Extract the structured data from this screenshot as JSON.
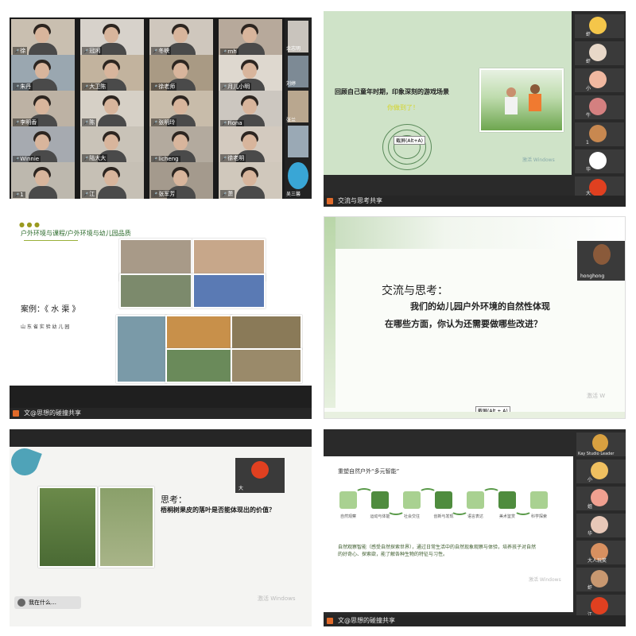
{
  "p1": {
    "tiles": [
      {
        "name": "徐"
      },
      {
        "name": "冠闲"
      },
      {
        "name": "冬峡"
      },
      {
        "name": "rnh"
      },
      {
        "name": "朱丹"
      },
      {
        "name": "大卫陈"
      },
      {
        "name": "徐老师"
      },
      {
        "name": "月儿小明"
      },
      {
        "name": "李明香"
      },
      {
        "name": "陈"
      },
      {
        "name": "张明玲"
      },
      {
        "name": "Fiona"
      },
      {
        "name": "Winnie"
      },
      {
        "name": "陆大大"
      },
      {
        "name": "licheng"
      },
      {
        "name": "徐老明"
      },
      {
        "name": "1"
      },
      {
        "name": "江"
      },
      {
        "name": "张军芳"
      },
      {
        "name": "萧"
      }
    ],
    "right_names": [
      "交流与时",
      "honghong",
      "余志明",
      "刘婷",
      "张兰"
    ],
    "bottom_name": "吴三馨"
  },
  "p2": {
    "title": "回顾自己童年时期，印象深刻的游戏场景",
    "subtitle": "你做到了！",
    "stamp": "截屏(Alt+A)",
    "watermark": "激活 Windows",
    "bar_text": "交流与思考共享",
    "participants": [
      "虾",
      "虾",
      "小",
      "牛",
      "1",
      "华",
      "大"
    ]
  },
  "p3": {
    "title": "户外环境与课程/户外环境与幼儿园品质",
    "caption": "案例：《 水 渠 》",
    "school": "山 东 省 实 验 幼 儿 园",
    "bar_text": "文@思想的碰撞共享"
  },
  "p4": {
    "heading": "交流与思考：",
    "line1": "我们的幼儿园户外环境的自然性体现",
    "line2": "在哪些方面，你认为还需要做哪些改进？",
    "presenter": "honghong",
    "stamp": "截屏(Alt + A)",
    "watermark": "激活 W"
  },
  "p5": {
    "heading": "思考：",
    "question": "梧桐树果皮的落叶是否能体现出的价值？",
    "presenter": "大",
    "chip": "我在什么…",
    "watermark": "激活 Windows"
  },
  "p6": {
    "title": "重塑自然户外“多元智能”",
    "labels": [
      "自然观察",
      "运动与体能",
      "社会交往",
      "创新与发现",
      "语言表达",
      "美术鉴赏",
      "科学探索"
    ],
    "body": "自然观察智能（感受自然探索世界），通过日常生活中的自然现象观察与体验，培养孩子对自然的好奇心、探索欲，能了解各种生物的特征与习性。",
    "watermark": "激活 Windows",
    "bar_text": "文@思想的碰撞共享",
    "host": "Kay Studio Leader",
    "participants": [
      "小",
      "姐",
      "华",
      "大人玩笑",
      "虾",
      "江"
    ]
  },
  "colors": {
    "sage": "#cfe3c8",
    "green_dark": "#4f8c3e",
    "green_light": "#a9d191",
    "accent_yellow": "#e0e020"
  }
}
